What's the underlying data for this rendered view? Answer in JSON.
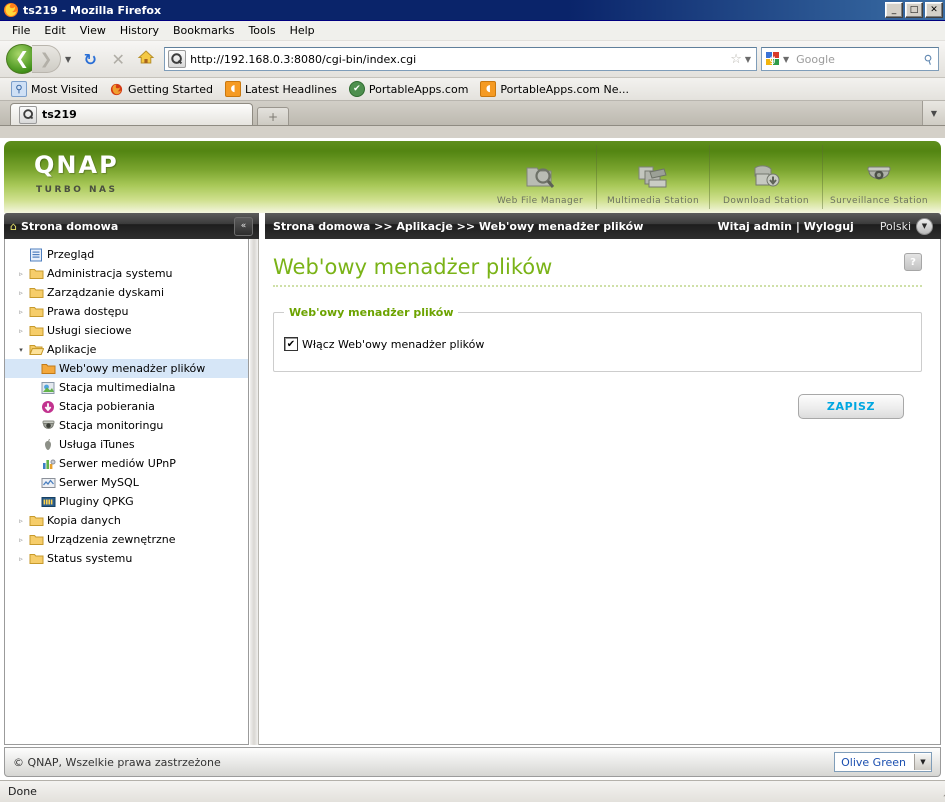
{
  "window": {
    "title": "ts219 - Mozilla Firefox",
    "icon": "firefox-icon",
    "minimize_label": "_",
    "maximize_label": "□",
    "close_label": "✕"
  },
  "menubar": {
    "items": [
      {
        "label": "File"
      },
      {
        "label": "Edit"
      },
      {
        "label": "View"
      },
      {
        "label": "History"
      },
      {
        "label": "Bookmarks"
      },
      {
        "label": "Tools"
      },
      {
        "label": "Help"
      }
    ]
  },
  "toolbar": {
    "back_label": "❮",
    "forward_label": "❯",
    "dropdown_label": "▼",
    "reload_label": "↻",
    "stop_label": "✕",
    "home_label": "⌂",
    "url": "http://192.168.0.3:8080/cgi-bin/index.cgi",
    "url_favicon": "qnap-site-icon",
    "star_label": "☆",
    "caret_label": "▼",
    "search_placeholder": "Google",
    "search_value": "",
    "search_engine_icon": "google-icon",
    "search_go_label": "⚲"
  },
  "bookmarks": {
    "items": [
      {
        "label": "Most Visited",
        "icon": "most-visited-icon"
      },
      {
        "label": "Getting Started",
        "icon": "firefox-icon"
      },
      {
        "label": "Latest Headlines",
        "icon": "rss-icon"
      },
      {
        "label": "PortableApps.com",
        "icon": "portableapps-icon"
      },
      {
        "label": "PortableApps.com Ne...",
        "icon": "rss-icon"
      }
    ]
  },
  "tabs": {
    "active": {
      "label": "ts219",
      "icon": "qnap-site-icon"
    },
    "new_tab_label": "+",
    "list_all_label": "▼"
  },
  "banner": {
    "logo": "QNAP",
    "tagline": "TURBO NAS",
    "stations": [
      {
        "label": "Web File Manager",
        "icon": "web-file-manager-icon"
      },
      {
        "label": "Multimedia Station",
        "icon": "multimedia-station-icon"
      },
      {
        "label": "Download Station",
        "icon": "download-station-icon"
      },
      {
        "label": "Surveillance Station",
        "icon": "surveillance-station-icon"
      }
    ]
  },
  "navstrip": {
    "home_label": "Strona domowa",
    "home_icon": "home-icon",
    "collapse_label": "«",
    "breadcrumb": "Strona domowa >> Aplikacje >> Web'owy menadżer plików",
    "welcome": "Witaj admin | Wyloguj",
    "language": "Polski",
    "language_icon": "chevron-down-icon"
  },
  "sidebar": {
    "items": [
      {
        "label": "Przegląd",
        "icon": "overview-icon",
        "twisty": "",
        "level": 0,
        "selected": false
      },
      {
        "label": "Administracja systemu",
        "icon": "folder-icon",
        "twisty": "▹",
        "level": 0,
        "selected": false
      },
      {
        "label": "Zarządzanie dyskami",
        "icon": "folder-icon",
        "twisty": "▹",
        "level": 0,
        "selected": false
      },
      {
        "label": "Prawa dostępu",
        "icon": "folder-icon",
        "twisty": "▹",
        "level": 0,
        "selected": false
      },
      {
        "label": "Usługi sieciowe",
        "icon": "folder-icon",
        "twisty": "▹",
        "level": 0,
        "selected": false
      },
      {
        "label": "Aplikacje",
        "icon": "folder-open-icon",
        "twisty": "▾",
        "level": 0,
        "selected": false
      },
      {
        "label": "Web'owy menadżer plików",
        "icon": "folder-orange-icon",
        "twisty": "",
        "level": 1,
        "selected": true
      },
      {
        "label": "Stacja multimedialna",
        "icon": "multimedia-icon",
        "twisty": "",
        "level": 1,
        "selected": false
      },
      {
        "label": "Stacja pobierania",
        "icon": "download-icon",
        "twisty": "",
        "level": 1,
        "selected": false
      },
      {
        "label": "Stacja monitoringu",
        "icon": "camera-icon",
        "twisty": "",
        "level": 1,
        "selected": false
      },
      {
        "label": "Usługa iTunes",
        "icon": "apple-icon",
        "twisty": "",
        "level": 1,
        "selected": false
      },
      {
        "label": "Serwer mediów UPnP",
        "icon": "upnp-icon",
        "twisty": "",
        "level": 1,
        "selected": false
      },
      {
        "label": "Serwer MySQL",
        "icon": "mysql-icon",
        "twisty": "",
        "level": 1,
        "selected": false
      },
      {
        "label": "Pluginy QPKG",
        "icon": "qpkg-icon",
        "twisty": "",
        "level": 1,
        "selected": false
      },
      {
        "label": "Kopia danych",
        "icon": "folder-icon",
        "twisty": "▹",
        "level": 0,
        "selected": false
      },
      {
        "label": "Urządzenia zewnętrzne",
        "icon": "folder-icon",
        "twisty": "▹",
        "level": 0,
        "selected": false
      },
      {
        "label": "Status systemu",
        "icon": "folder-icon",
        "twisty": "▹",
        "level": 0,
        "selected": false
      }
    ]
  },
  "content": {
    "page_title": "Web'owy menadżer plików",
    "help_label": "?",
    "fieldset_legend": "Web'owy menadżer plików",
    "checkbox_label": "Włącz Web'owy menadżer plików",
    "checkbox_checked": true,
    "checkbox_mark": "✔",
    "save_label": "ZAPISZ"
  },
  "footer": {
    "copyright": "© QNAP, Wszelkie prawa zastrzeżone",
    "theme_value": "Olive Green",
    "theme_arrow": "▼"
  },
  "statusbar": {
    "text": "Done",
    "grip": "◢"
  },
  "colors": {
    "accent_green": "#7ab317",
    "legend_green": "#6ca300",
    "save_blue": "#00a7e1",
    "selection_blue": "#d6e6f7",
    "titlebar_blue": "#0a246a"
  }
}
